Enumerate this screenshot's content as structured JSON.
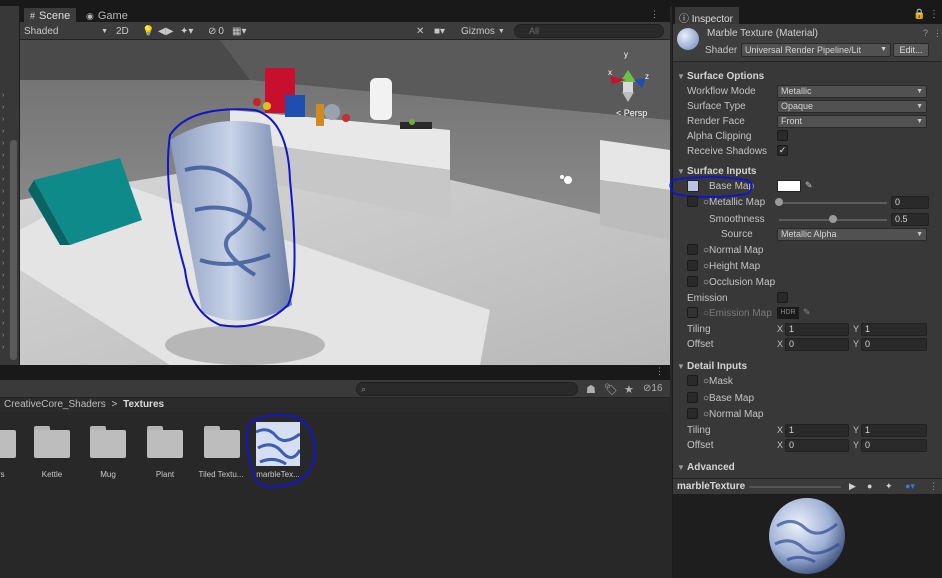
{
  "scene_view": {
    "tabs": [
      {
        "label": "Scene"
      },
      {
        "label": "Game"
      }
    ],
    "shading_mode": "Shaded",
    "toggle_2d": "2D",
    "hidden_count": "0",
    "gizmos_label": "Gizmos",
    "search_placeholder": "All",
    "orientation_label": "< Persp",
    "gizmo_axes": {
      "y": "y",
      "x": "x",
      "z": "z"
    }
  },
  "project": {
    "hidden_count": "16",
    "breadcrumb": {
      "parent": "CreativeCore_Shaders",
      "separator": ">",
      "current": "Textures"
    },
    "assets": [
      {
        "label": "ters"
      },
      {
        "label": "Kettle"
      },
      {
        "label": "Mug"
      },
      {
        "label": "Plant"
      },
      {
        "label": "Tiled Textu..."
      },
      {
        "label": "marbleTex..."
      }
    ]
  },
  "inspector": {
    "tab_label": "Inspector",
    "material_name": "Marble Texture (Material)",
    "shader_label": "Shader",
    "shader_value": "Universal Render Pipeline/Lit",
    "edit_button": "Edit...",
    "surface_options": {
      "title": "Surface Options",
      "workflow_mode": {
        "label": "Workflow Mode",
        "value": "Metallic"
      },
      "surface_type": {
        "label": "Surface Type",
        "value": "Opaque"
      },
      "render_face": {
        "label": "Render Face",
        "value": "Front"
      },
      "alpha_clipping": {
        "label": "Alpha Clipping",
        "checked": false
      },
      "receive_shadows": {
        "label": "Receive Shadows",
        "checked": true,
        "mark": "✓"
      }
    },
    "surface_inputs": {
      "title": "Surface Inputs",
      "base_map": "Base Map",
      "base_color": "#ffffff",
      "metallic_map": {
        "label": "Metallic Map",
        "value": "0",
        "level": 0.0
      },
      "smoothness": {
        "label": "Smoothness",
        "value": "0.5",
        "level": 0.5
      },
      "source": {
        "label": "Source",
        "value": "Metallic Alpha"
      },
      "normal_map": "Normal Map",
      "height_map": "Height Map",
      "occlusion_map": "Occlusion Map",
      "emission": "Emission",
      "emission_map": "Emission Map",
      "hdr_label": "HDR",
      "tiling": {
        "label": "Tiling",
        "x_label": "X",
        "x": "1",
        "y_label": "Y",
        "y": "1"
      },
      "offset": {
        "label": "Offset",
        "x_label": "X",
        "x": "0",
        "y_label": "Y",
        "y": "0"
      }
    },
    "detail_inputs": {
      "title": "Detail Inputs",
      "mask": "Mask",
      "base_map": "Base Map",
      "normal_map": "Normal Map",
      "tiling": {
        "label": "Tiling",
        "x_label": "X",
        "x": "1",
        "y_label": "Y",
        "y": "1"
      },
      "offset": {
        "label": "Offset",
        "x_label": "X",
        "x": "0",
        "y_label": "Y",
        "y": "0"
      }
    },
    "advanced": {
      "title": "Advanced"
    },
    "preview": {
      "title": "marbleTexture"
    }
  },
  "colors": {
    "annotation": "#0f17c8",
    "accent_blue": "#3a79d8",
    "teal_box": "#0f8a8a"
  }
}
